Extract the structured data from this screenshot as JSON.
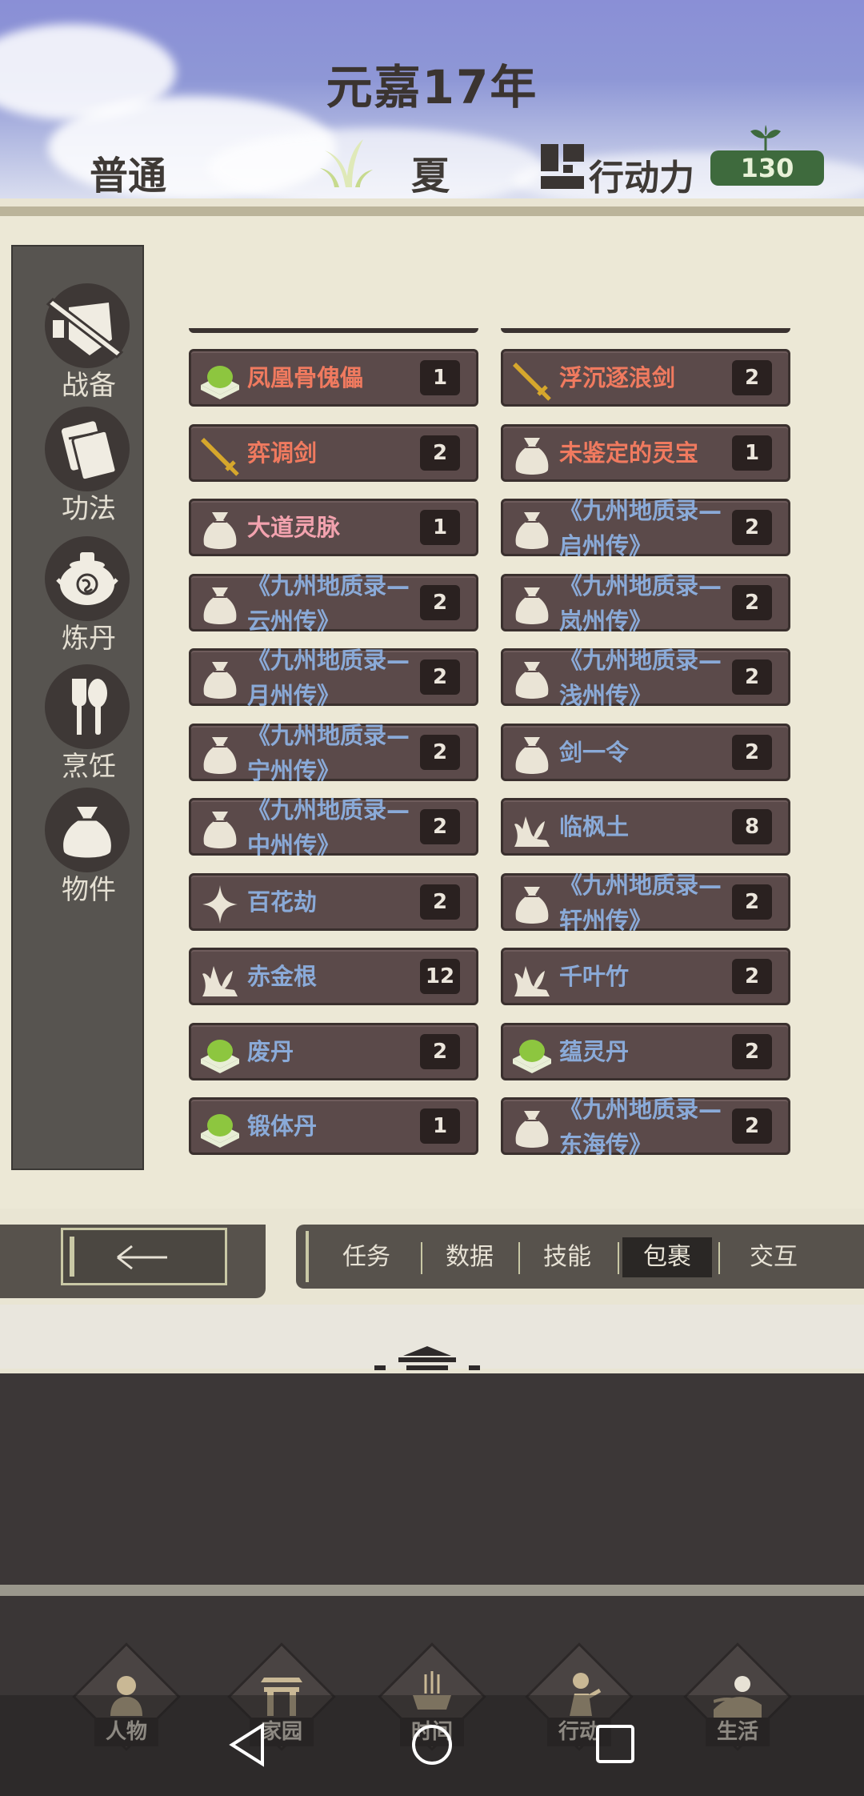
{
  "header": {
    "year": "元嘉17年",
    "mode": "普通",
    "season": "夏",
    "ap_label": "行动力",
    "ap_value": "130"
  },
  "sidebar": {
    "items": [
      {
        "label": "战备",
        "icon": "sword-shield-icon"
      },
      {
        "label": "功法",
        "icon": "books-icon"
      },
      {
        "label": "炼丹",
        "icon": "alchemy-cauldron-icon"
      },
      {
        "label": "烹饪",
        "icon": "cooking-utensils-icon"
      },
      {
        "label": "物件",
        "icon": "bag-icon"
      }
    ]
  },
  "inventory": {
    "left": [
      {
        "name": "凤凰骨傀儡",
        "count": "1",
        "color": "orange",
        "icon": "pill-icon"
      },
      {
        "name": "弈调剑",
        "count": "2",
        "color": "orange",
        "icon": "sword-icon"
      },
      {
        "name": "大道灵脉",
        "count": "1",
        "color": "pink",
        "icon": "bag-icon"
      },
      {
        "name": "《九州地质录—\n云州传》",
        "count": "2",
        "color": "blue",
        "icon": "bag-icon"
      },
      {
        "name": "《九州地质录—\n月州传》",
        "count": "2",
        "color": "blue",
        "icon": "bag-icon"
      },
      {
        "name": "《九州地质录—\n宁州传》",
        "count": "2",
        "color": "blue",
        "icon": "bag-icon"
      },
      {
        "name": "《九州地质录—\n中州传》",
        "count": "2",
        "color": "blue",
        "icon": "bag-icon"
      },
      {
        "name": "百花劫",
        "count": "2",
        "color": "blue",
        "icon": "sparkle-icon"
      },
      {
        "name": "赤金根",
        "count": "12",
        "color": "blue",
        "icon": "herb-icon"
      },
      {
        "name": "废丹",
        "count": "2",
        "color": "blue",
        "icon": "pill-icon"
      },
      {
        "name": "锻体丹",
        "count": "1",
        "color": "blue",
        "icon": "pill-icon"
      }
    ],
    "right": [
      {
        "name": "浮沉逐浪剑",
        "count": "2",
        "color": "orange",
        "icon": "sword-icon"
      },
      {
        "name": "未鉴定的灵宝",
        "count": "1",
        "color": "orange",
        "icon": "bag-icon"
      },
      {
        "name": "《九州地质录—\n启州传》",
        "count": "2",
        "color": "blue",
        "icon": "bag-icon"
      },
      {
        "name": "《九州地质录—\n岚州传》",
        "count": "2",
        "color": "blue",
        "icon": "bag-icon"
      },
      {
        "name": "《九州地质录—\n浅州传》",
        "count": "2",
        "color": "blue",
        "icon": "bag-icon"
      },
      {
        "name": "剑一令",
        "count": "2",
        "color": "blue",
        "icon": "bag-icon"
      },
      {
        "name": "临枫土",
        "count": "8",
        "color": "blue",
        "icon": "herb-icon"
      },
      {
        "name": "《九州地质录—\n轩州传》",
        "count": "2",
        "color": "blue",
        "icon": "bag-icon"
      },
      {
        "name": "千叶竹",
        "count": "2",
        "color": "blue",
        "icon": "herb-icon"
      },
      {
        "name": "蕴灵丹",
        "count": "2",
        "color": "blue",
        "icon": "pill-icon"
      },
      {
        "name": "《九州地质录—\n东海传》",
        "count": "2",
        "color": "blue",
        "icon": "bag-icon"
      }
    ]
  },
  "tabs": [
    {
      "label": "任务"
    },
    {
      "label": "数据"
    },
    {
      "label": "技能"
    },
    {
      "label": "包裹",
      "active": true
    },
    {
      "label": "交互"
    }
  ],
  "bottom_nav": [
    {
      "label": "人物"
    },
    {
      "label": "家园"
    },
    {
      "label": "时间"
    },
    {
      "label": "行动"
    },
    {
      "label": "生活"
    }
  ],
  "colors": {
    "orange": "#f07a5f",
    "pink": "#f2a2ae",
    "blue": "#8aaad8",
    "ap_badge": "#3e6a3d"
  }
}
